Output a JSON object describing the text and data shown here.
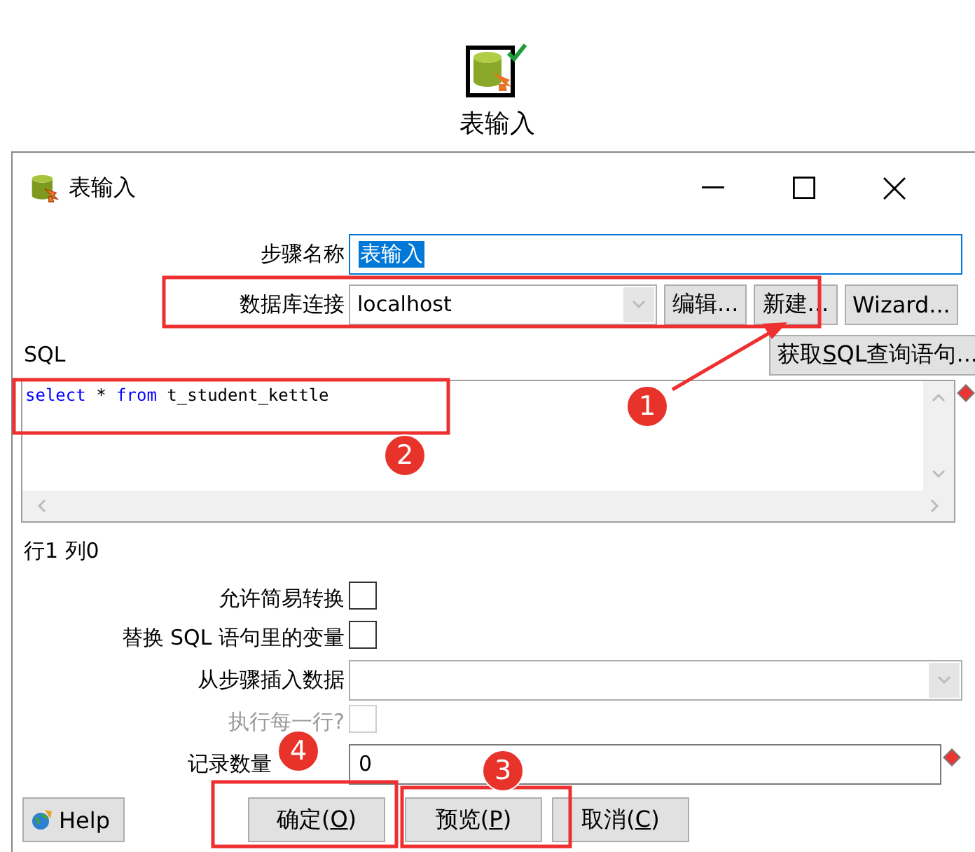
{
  "canvas_step": {
    "label": "表输入"
  },
  "dialog": {
    "title": "表输入"
  },
  "step_name": {
    "label": "步骤名称",
    "value": "表输入"
  },
  "connection": {
    "label": "数据库连接",
    "value": "localhost",
    "buttons": [
      "编辑...",
      "新建...",
      "Wizard..."
    ]
  },
  "sql": {
    "label": "SQL",
    "get_button": {
      "pre": "获取",
      "key": "S",
      "post": "QL查询语句..."
    },
    "tokens": [
      {
        "kind": "keyword",
        "text": "select"
      },
      {
        "kind": "plain",
        "text": " * "
      },
      {
        "kind": "keyword",
        "text": "from"
      },
      {
        "kind": "plain",
        "text": " t_student_kettle"
      }
    ]
  },
  "cursor_position": "行1 列0",
  "options": [
    {
      "kind": "checkbox",
      "label": "允许简易转换",
      "checked": false,
      "disabled": false
    },
    {
      "kind": "checkbox",
      "label": "替换 SQL 语句里的变量",
      "checked": false,
      "disabled": false
    },
    {
      "kind": "dropdown",
      "label": "从步骤插入数据"
    },
    {
      "kind": "checkbox",
      "label": "执行每一行?",
      "checked": false,
      "disabled": true
    },
    {
      "kind": "text",
      "label": "记录数量",
      "value": "0"
    }
  ],
  "buttons": [
    {
      "kind": "help",
      "label": "Help"
    },
    {
      "kind": "mnemonic",
      "pre": "确定(",
      "key": "O",
      "post": ")"
    },
    {
      "kind": "mnemonic",
      "pre": "预览(",
      "key": "P",
      "post": ")"
    },
    {
      "kind": "mnemonic",
      "pre": "取消(",
      "key": "C",
      "post": ")"
    }
  ],
  "annotations": [
    "1",
    "2",
    "3",
    "4"
  ]
}
